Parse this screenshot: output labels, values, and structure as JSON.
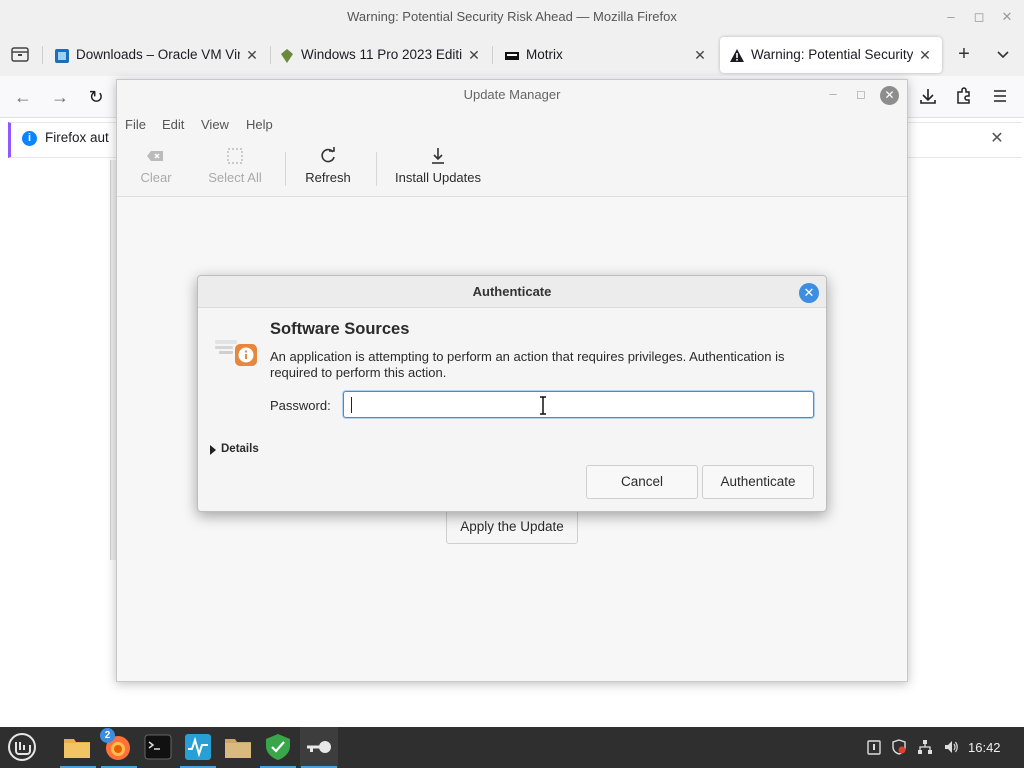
{
  "firefox": {
    "window_title": "Warning: Potential Security Risk Ahead — Mozilla Firefox",
    "tabs": [
      {
        "label": "Downloads – Oracle VM Virt",
        "icon": "virtualbox-icon"
      },
      {
        "label": "Windows 11 Pro 2023 Editio",
        "icon": "torrent-icon"
      },
      {
        "label": "Motrix",
        "icon": "motrix-icon"
      },
      {
        "label": "Warning: Potential Security",
        "icon": "warning-icon"
      }
    ],
    "notification": {
      "text": "Firefox aut"
    }
  },
  "update_manager": {
    "title": "Update Manager",
    "menu": [
      "File",
      "Edit",
      "View",
      "Help"
    ],
    "toolbar": {
      "clear": "Clear",
      "select_all": "Select All",
      "refresh": "Refresh",
      "install_updates": "Install Updates"
    },
    "apply_button": "Apply the Update"
  },
  "auth_dialog": {
    "title": "Authenticate",
    "heading": "Software Sources",
    "message": "An application is attempting to perform an action that requires privileges. Authentication is required to perform this action.",
    "password_label": "Password:",
    "password_value": "",
    "details_label": "Details",
    "cancel_label": "Cancel",
    "authenticate_label": "Authenticate"
  },
  "taskbar": {
    "clock": "16:42",
    "notification_badge": "2",
    "accent": "#4aa3df"
  },
  "colors": {
    "focus_blue": "#3d8ee0",
    "firefox_purple": "#9059ff"
  }
}
